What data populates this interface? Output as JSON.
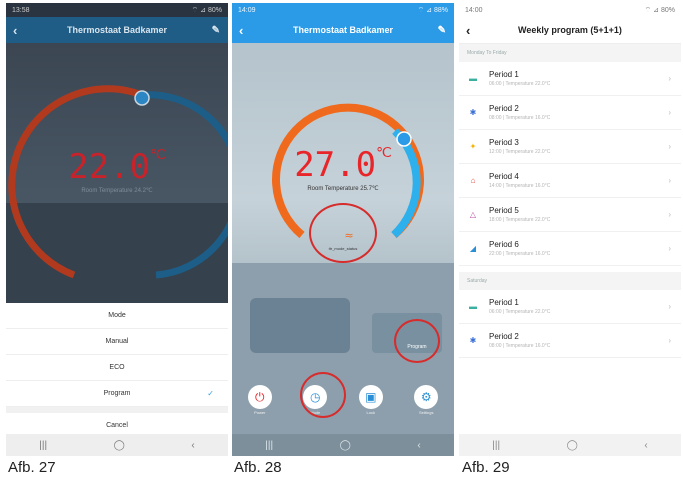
{
  "phone1": {
    "status_time": "13:58",
    "status_right": "⌔ ⊿ 80%",
    "title": "Thermostaat Badkamer",
    "temperature": "22.0",
    "unit": "℃",
    "room_temperature": "Room Temperature 24.2℃",
    "sheet": {
      "title": "Mode",
      "options": [
        "Manual",
        "ECO",
        "Program"
      ],
      "selected": "Program",
      "cancel": "Cancel"
    }
  },
  "phone2": {
    "status_time": "14:09",
    "status_right": "⌔ ⊿ 88%",
    "title": "Thermostaat Badkamer",
    "temperature": "27.0",
    "unit": "℃",
    "room_temperature": "Room Temperature 25.7℃",
    "heating_label": "ttr_mode_status",
    "program_label": "Program",
    "controls": [
      {
        "label": "Power",
        "icon": "power-icon",
        "color": "#e8262a"
      },
      {
        "label": "Mode",
        "icon": "clock-icon",
        "color": "#2a8fd6"
      },
      {
        "label": "Lock",
        "icon": "lock-icon",
        "color": "#2a8fd6"
      },
      {
        "label": "Settings",
        "icon": "gear-icon",
        "color": "#2a8fd6"
      }
    ]
  },
  "phone3": {
    "status_time": "14:00",
    "status_right": "⌔ ⊿ 80%",
    "title": "Weekly program (5+1+1)",
    "sections": [
      {
        "header": "Monday To Friday",
        "periods": [
          {
            "name": "Period 1",
            "detail": "06:00 | Temperature 22.0°C",
            "icon": "sunrise-icon",
            "color": "#3ab0a0"
          },
          {
            "name": "Period 2",
            "detail": "08:00 | Temperature 16.0°C",
            "icon": "briefcase-icon",
            "color": "#3a6fd6"
          },
          {
            "name": "Period 3",
            "detail": "12:00 | Temperature 22.0°C",
            "icon": "sun-icon",
            "color": "#f4b400"
          },
          {
            "name": "Period 4",
            "detail": "14:00 | Temperature 16.0°C",
            "icon": "home-icon",
            "color": "#e8453c"
          },
          {
            "name": "Period 5",
            "detail": "18:00 | Temperature 22.0°C",
            "icon": "evening-icon",
            "color": "#b84aa0"
          },
          {
            "name": "Period 6",
            "detail": "22:00 | Temperature 16.0°C",
            "icon": "night-icon",
            "color": "#2a8fd6"
          }
        ]
      },
      {
        "header": "Saturday",
        "periods": [
          {
            "name": "Period 1",
            "detail": "06:00 | Temperature 22.0°C",
            "icon": "sunrise-icon",
            "color": "#3ab0a0"
          },
          {
            "name": "Period 2",
            "detail": "08:00 | Temperature 16.0°C",
            "icon": "briefcase-icon",
            "color": "#3a6fd6"
          }
        ]
      }
    ]
  },
  "captions": [
    "Afb. 27",
    "Afb. 28",
    "Afb. 29"
  ],
  "colors": {
    "accent_blue": "#2b9be8",
    "hot_red": "#e8262a",
    "annotation_red": "#d62c2c"
  }
}
